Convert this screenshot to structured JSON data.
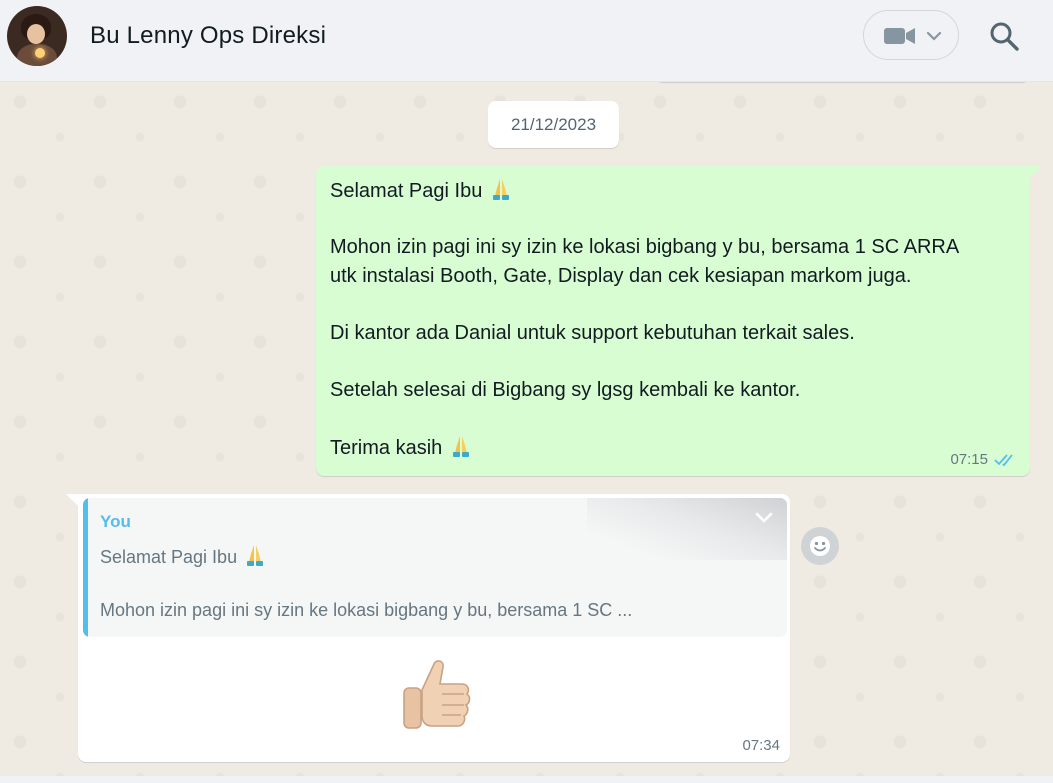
{
  "header": {
    "contact_name": "Bu Lenny Ops Direksi",
    "icons": [
      "avatar",
      "video-call-icon",
      "chevron-down-icon",
      "search-icon"
    ]
  },
  "chat": {
    "date_chip": "21/12/2023",
    "outgoing": {
      "lines": [
        "Selamat Pagi Ibu",
        "Mohon izin pagi ini sy izin ke lokasi bigbang y bu, bersama 1 SC ARRA",
        "utk instalasi Booth, Gate, Display dan cek kesiapan markom juga.",
        "Di kantor ada Danial untuk support kebutuhan terkait sales.",
        "Setelah selesai di Bigbang sy lgsg kembali ke kantor.",
        "Terima kasih"
      ],
      "time": "07:15",
      "status_icon": "double-check-read-icon"
    },
    "incoming": {
      "quote_author": "You",
      "quote_line1": "Selamat Pagi Ibu",
      "quote_line2": "Mohon izin pagi ini sy izin ke lokasi bigbang y bu, bersama 1 SC ...",
      "emoji": "thumbs-up",
      "time": "07:34"
    },
    "reaction_icon": "emoji-smiley-icon"
  },
  "colors": {
    "outgoing_bubble": "#d9fdd3",
    "incoming_bubble": "#ffffff",
    "quote_accent": "#53bdeb",
    "read_check": "#53bdeb",
    "background": "#efeae2"
  }
}
